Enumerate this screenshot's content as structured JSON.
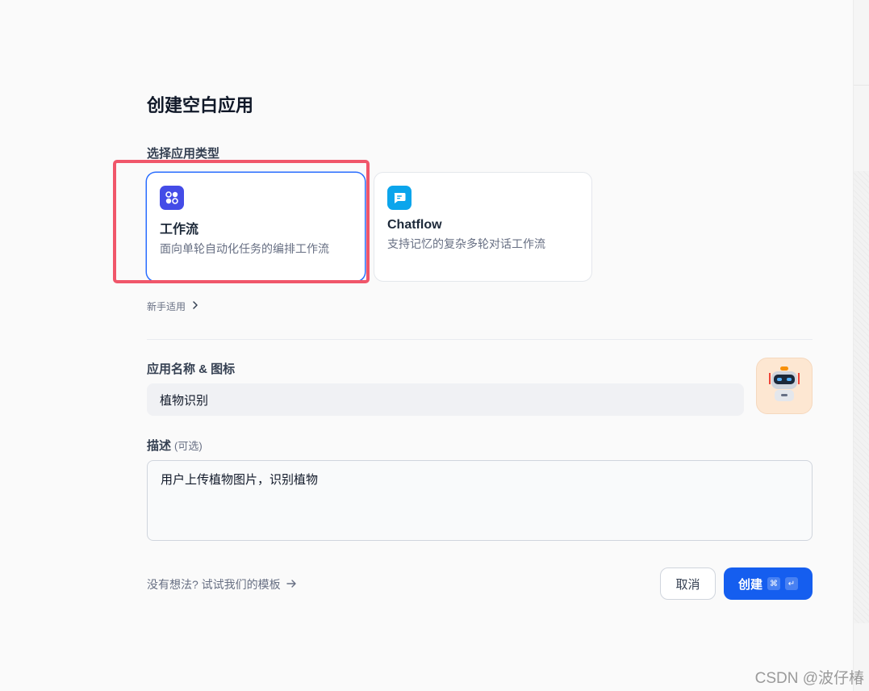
{
  "page": {
    "title": "创建空白应用"
  },
  "app_type": {
    "label": "选择应用类型",
    "options": [
      {
        "title": "工作流",
        "description": "面向单轮自动化任务的编排工作流",
        "icon": "workflow-icon",
        "color": "#444ce7",
        "selected": true
      },
      {
        "title": "Chatflow",
        "description": "支持记忆的复杂多轮对话工作流",
        "icon": "chat-bubble-icon",
        "color": "#0ba5ec",
        "selected": false
      }
    ],
    "beginner_link": "新手适用"
  },
  "app_name": {
    "label": "应用名称 & 图标",
    "value": "植物识别",
    "icon": "robot-icon"
  },
  "description": {
    "label": "描述",
    "optional": "(可选)",
    "value": "用户上传植物图片，识别植物"
  },
  "footer": {
    "template_link": "没有想法? 试试我们的模板",
    "cancel_label": "取消",
    "create_label": "创建",
    "shortcut_keys": [
      "⌘",
      "↵"
    ]
  },
  "watermark": "CSDN @波仔椿",
  "colors": {
    "primary": "#155eef",
    "highlight": "#f0566a"
  }
}
